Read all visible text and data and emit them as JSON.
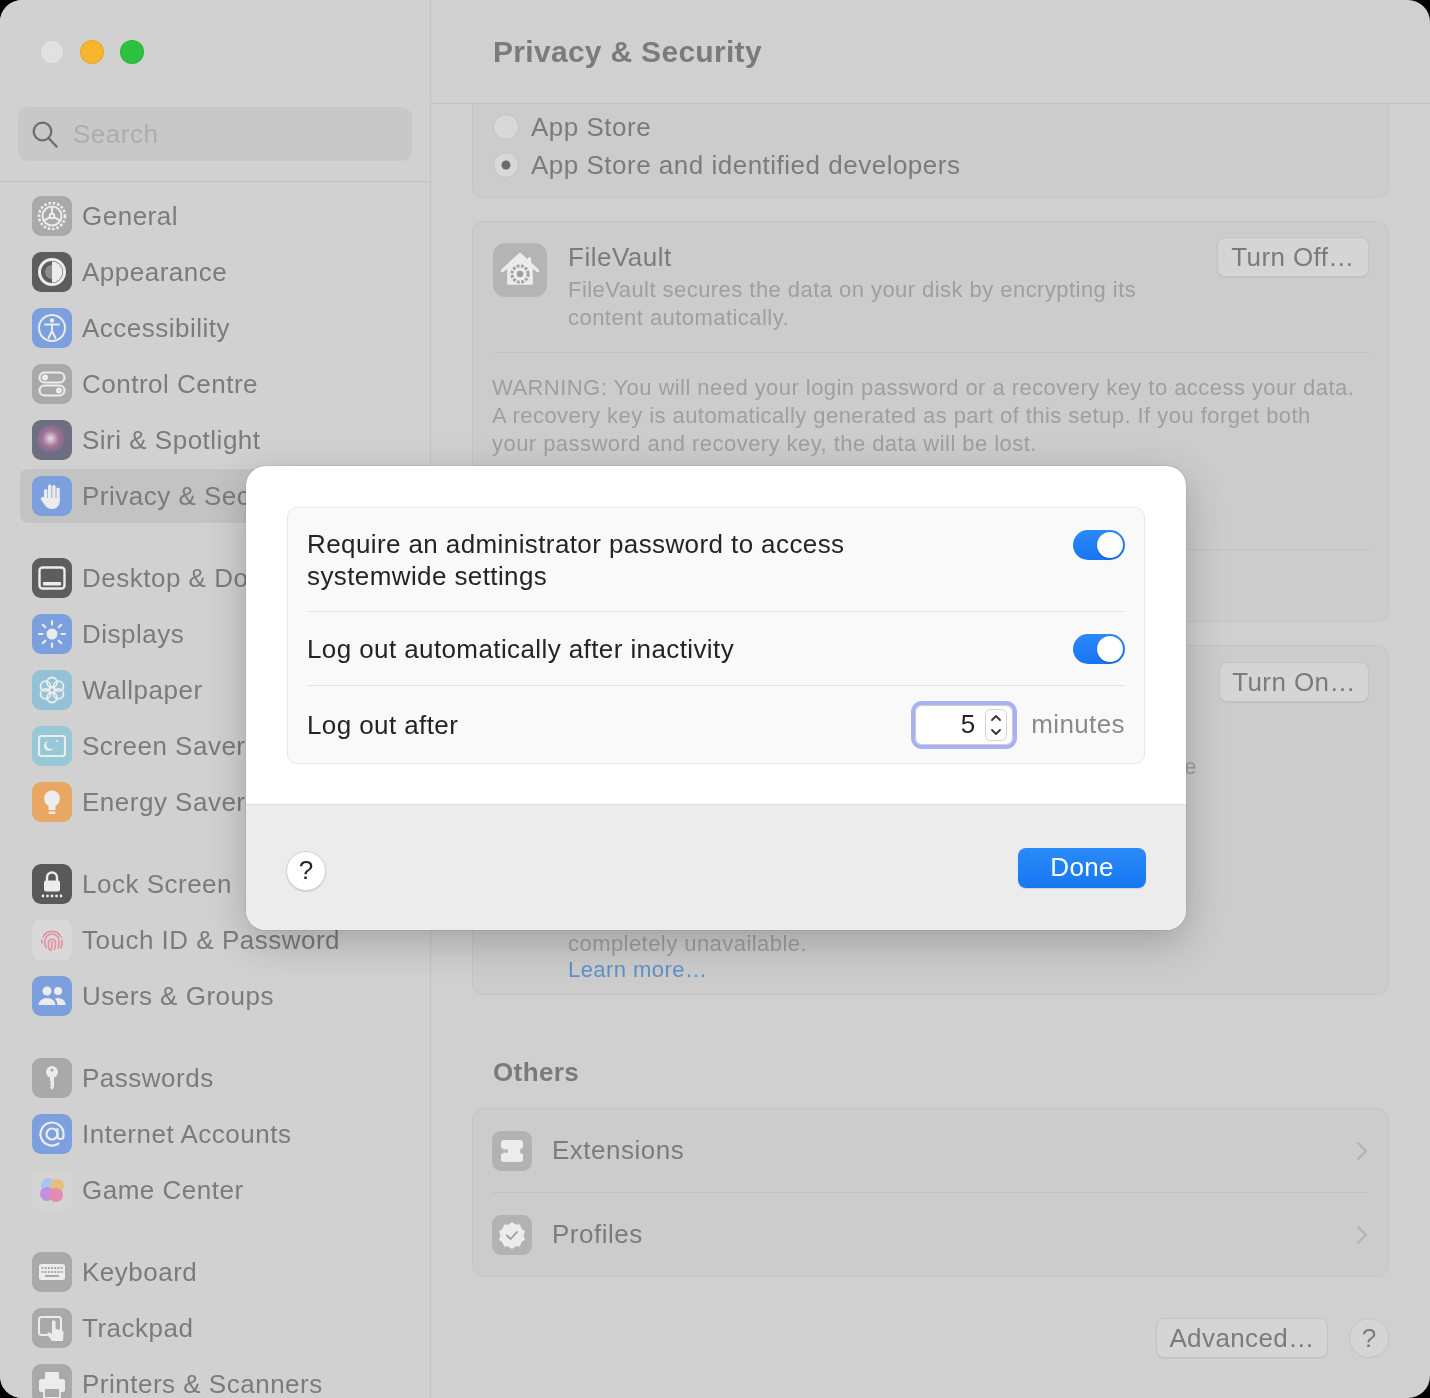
{
  "window": {
    "controls": [
      {
        "kind": "close",
        "disabled": true
      },
      {
        "kind": "minimize",
        "disabled": false
      },
      {
        "kind": "zoom",
        "disabled": false
      }
    ]
  },
  "sidebar": {
    "search": {
      "placeholder": "Search"
    },
    "groups": [
      {
        "items": [
          {
            "label": "General",
            "selected": false
          },
          {
            "label": "Appearance",
            "selected": false
          },
          {
            "label": "Accessibility",
            "selected": false
          },
          {
            "label": "Control Centre",
            "selected": false
          },
          {
            "label": "Siri & Spotlight",
            "selected": false
          },
          {
            "label": "Privacy & Sec",
            "selected": true
          }
        ]
      },
      {
        "items": [
          {
            "label": "Desktop & Do",
            "selected": false
          },
          {
            "label": "Displays",
            "selected": false
          },
          {
            "label": "Wallpaper",
            "selected": false
          },
          {
            "label": "Screen Saver",
            "selected": false
          },
          {
            "label": "Energy Saver",
            "selected": false
          }
        ]
      },
      {
        "items": [
          {
            "label": "Lock Screen",
            "selected": false
          },
          {
            "label": "Touch ID & Password",
            "selected": false
          },
          {
            "label": "Users & Groups",
            "selected": false
          }
        ]
      },
      {
        "items": [
          {
            "label": "Passwords",
            "selected": false
          },
          {
            "label": "Internet Accounts",
            "selected": false
          },
          {
            "label": "Game Center",
            "selected": false
          }
        ]
      },
      {
        "items": [
          {
            "label": "Keyboard",
            "selected": false
          },
          {
            "label": "Trackpad",
            "selected": false
          },
          {
            "label": "Printers & Scanners",
            "selected": false
          }
        ]
      }
    ]
  },
  "main": {
    "title": "Privacy & Security",
    "app_sources": [
      {
        "label": "App Store",
        "selected": false
      },
      {
        "label": "App Store and identified developers",
        "selected": true
      }
    ],
    "filevault": {
      "title": "FileVault",
      "description": "FileVault secures the data on your disk by encrypting its content automatically.",
      "button": "Turn Off…",
      "warning": "WARNING: You will need your login password or a recovery key to access your data. A recovery key is automatically generated as part of this setup. If you forget both your password and recovery key, the data will be lost."
    },
    "card_3": {
      "button": "Turn On…",
      "fragment": "e",
      "description_end": "completely unavailable.",
      "link": "Learn more…"
    },
    "others": {
      "heading": "Others",
      "items": [
        {
          "label": "Extensions"
        },
        {
          "label": "Profiles"
        }
      ]
    },
    "advanced_button": "Advanced…",
    "help_button": "?"
  },
  "sheet": {
    "settings": [
      {
        "kind": "toggle",
        "label": "Require an administrator password to access systemwide settings",
        "on": true
      },
      {
        "kind": "toggle",
        "label": "Log out automatically after inactivity",
        "on": true
      },
      {
        "kind": "stepper",
        "label": "Log out after",
        "value": "5",
        "unit": "minutes",
        "focused": true
      }
    ],
    "help_button": "?",
    "done_button": "Done"
  }
}
